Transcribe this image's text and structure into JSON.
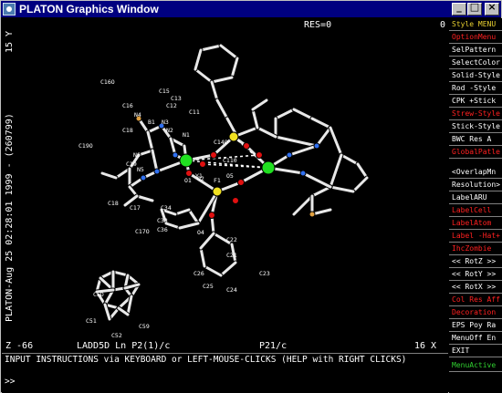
{
  "window": {
    "title": "PLATON Graphics Window",
    "minimize_glyph": "_",
    "maximize_glyph": "□",
    "close_glyph": "×"
  },
  "canvas": {
    "res_label": "RES=0",
    "zero_label": "0",
    "top_left_label": "15 Y",
    "left_vertical_label": "PLATON-Aug 25 02:28:01 1999 - (260799)",
    "bottom_left_label": "Z  -66",
    "bottom_code_label": "LADD5D Ln P2(1)/c",
    "bottom_space_group": "P21/c",
    "bottom_right_label": "16 X"
  },
  "atom_labels": [
    {
      "text": "C16O",
      "c": "w"
    },
    {
      "text": "C15",
      "c": "w"
    },
    {
      "text": "C13",
      "c": "w"
    },
    {
      "text": "C16",
      "c": "w"
    },
    {
      "text": "C12",
      "c": "w"
    },
    {
      "text": "N4",
      "c": "w"
    },
    {
      "text": "C11",
      "c": "w"
    },
    {
      "text": "B1",
      "c": "w"
    },
    {
      "text": "N3",
      "c": "w"
    },
    {
      "text": "N2",
      "c": "w"
    },
    {
      "text": "C18",
      "c": "w"
    },
    {
      "text": "N1",
      "c": "w"
    },
    {
      "text": "C14O",
      "c": "w"
    },
    {
      "text": "C19O",
      "c": "w"
    },
    {
      "text": "N6",
      "c": "w"
    },
    {
      "text": "C19",
      "c": "w"
    },
    {
      "text": "N5",
      "c": "w"
    },
    {
      "text": "Y1",
      "c": "w"
    },
    {
      "text": "C110",
      "c": "w"
    },
    {
      "text": "O1",
      "c": "w"
    },
    {
      "text": "O2",
      "c": "w"
    },
    {
      "text": "F1",
      "c": "w"
    },
    {
      "text": "O5",
      "c": "w"
    },
    {
      "text": "C18",
      "c": "w"
    },
    {
      "text": "C17",
      "c": "w"
    },
    {
      "text": "C34",
      "c": "w"
    },
    {
      "text": "C33",
      "c": "w"
    },
    {
      "text": "C36",
      "c": "w"
    },
    {
      "text": "C17O",
      "c": "w"
    },
    {
      "text": "O4",
      "c": "w"
    },
    {
      "text": "C22",
      "c": "w"
    },
    {
      "text": "C21",
      "c": "w"
    },
    {
      "text": "C26",
      "c": "w"
    },
    {
      "text": "C25",
      "c": "w"
    },
    {
      "text": "C24",
      "c": "w"
    },
    {
      "text": "C23",
      "c": "w"
    },
    {
      "text": "C5D",
      "c": "w"
    },
    {
      "text": "C51",
      "c": "w"
    },
    {
      "text": "C52",
      "c": "w"
    },
    {
      "text": "C59",
      "c": "w"
    }
  ],
  "menu": {
    "items": [
      {
        "label": "Style  MENU",
        "color": "yellow"
      },
      {
        "label": "OptionMenu",
        "color": "red"
      },
      {
        "label": "SelPattern",
        "color": "white"
      },
      {
        "label": "SelectColor",
        "color": "white"
      },
      {
        "label": "Solid-Style",
        "color": "white"
      },
      {
        "label": "Rod  -Style",
        "color": "white"
      },
      {
        "label": "CPK  +Stick",
        "color": "white"
      },
      {
        "label": "Strew-Style",
        "color": "red"
      },
      {
        "label": "Stick-Style",
        "color": "white"
      },
      {
        "label": "BWC Res A",
        "color": "white"
      },
      {
        "label": "GlobalPatle",
        "color": "red"
      },
      {
        "label": "<OverlapMn",
        "color": "white"
      },
      {
        "label": "Resolution>",
        "color": "white"
      },
      {
        "label": "LabelARU",
        "color": "white"
      },
      {
        "label": "LabelCell",
        "color": "red"
      },
      {
        "label": "LabelAtom",
        "color": "red"
      },
      {
        "label": "Label -Hat+",
        "color": "red"
      },
      {
        "label": "IhcZombie",
        "color": "red"
      },
      {
        "label": "<< RotZ >>",
        "color": "white"
      },
      {
        "label": "<< RotY >>",
        "color": "white"
      },
      {
        "label": "<< RotX >>",
        "color": "white"
      },
      {
        "label": "Col Res Aff",
        "color": "red"
      },
      {
        "label": "Decoration",
        "color": "red"
      },
      {
        "label": "EPS Poy Ra",
        "color": "white"
      },
      {
        "label": "MenuOff En",
        "color": "white"
      },
      {
        "label": "EXIT",
        "color": "white"
      },
      {
        "label": "MenuActive",
        "color": "green"
      }
    ]
  },
  "status": {
    "instructions": "INPUT INSTRUCTIONS via KEYBOARD or LEFT-MOUSE-CLICKS (HELP with RIGHT CLICKS)",
    "prompt": ">>"
  },
  "colors": {
    "title_bar": "#000080",
    "menu_yellow": "#e8d030",
    "menu_red": "#ff2020",
    "menu_green": "#30d030",
    "atom_green": "#20e020",
    "atom_yellow": "#f0e020",
    "atom_red": "#e01010",
    "atom_blue": "#3070f0",
    "atom_orange": "#e0a040"
  }
}
